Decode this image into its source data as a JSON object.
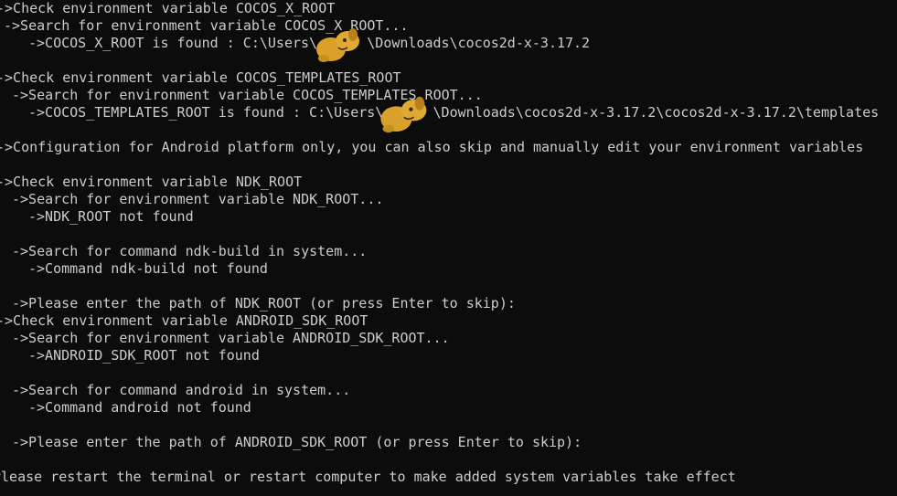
{
  "terminal": {
    "lines": [
      "->Check environment variable COCOS_X_ROOT",
      "->Search for environment variable COCOS_X_ROOT...",
      "->COCOS_X_ROOT is found : C:\\Users\\      \\Downloads\\cocos2d-x-3.17.2",
      "",
      "->Check environment variable COCOS_TEMPLATES_ROOT",
      "->Search for environment variable COCOS_TEMPLATES_ROOT...",
      "->COCOS_TEMPLATES_ROOT is found : C:\\Users\\      \\Downloads\\cocos2d-x-3.17.2\\cocos2d-x-3.17.2\\templates",
      "",
      "->Configuration for Android platform only, you can also skip and manually edit your environment variables",
      "",
      "->Check environment variable NDK_ROOT",
      "->Search for environment variable NDK_ROOT...",
      "->NDK_ROOT not found",
      "",
      "->Search for command ndk-build in system...",
      "->Command ndk-build not found",
      "",
      "->Please enter the path of NDK_ROOT (or press Enter to skip):",
      "->Check environment variable ANDROID_SDK_ROOT",
      "->Search for environment variable ANDROID_SDK_ROOT...",
      "->ANDROID_SDK_ROOT not found",
      "",
      "->Search for command android in system...",
      "->Command android not found",
      "",
      "->Please enter the path of ANDROID_SDK_ROOT (or press Enter to skip):",
      "",
      "Please restart the terminal or restart computer to make added system variables take effect"
    ]
  },
  "colors": {
    "background": "#0c0c0c",
    "text": "#cccccc",
    "redaction": "#d9a12a"
  }
}
